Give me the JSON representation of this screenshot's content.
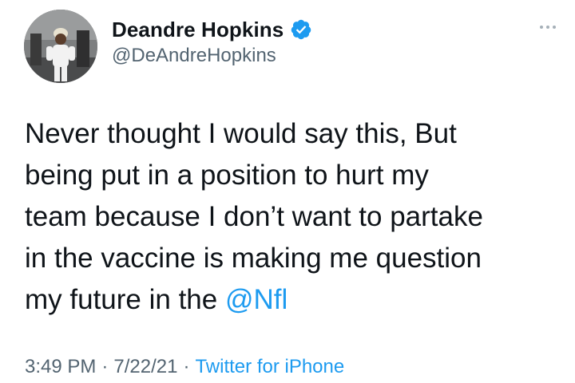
{
  "user": {
    "display_name": "Deandre Hopkins",
    "handle": "@DeAndreHopkins",
    "verified": true,
    "avatar_icon": "profile-photo"
  },
  "tweet": {
    "lines": [
      "Never thought I would say this, But",
      "being put in a position to hurt my",
      "team because I don’t want to partake",
      "in the vaccine is making me question",
      "my future in the "
    ],
    "mention": "@Nfl"
  },
  "meta": {
    "time": "3:49 PM",
    "separator": "·",
    "date": "7/22/21",
    "source": "Twitter for iPhone"
  },
  "icons": {
    "more": "more-options-icon",
    "verified": "verified-badge-icon"
  },
  "colors": {
    "link": "#1d9bf0",
    "secondary_text": "#536471",
    "primary_text": "#0f1419"
  }
}
